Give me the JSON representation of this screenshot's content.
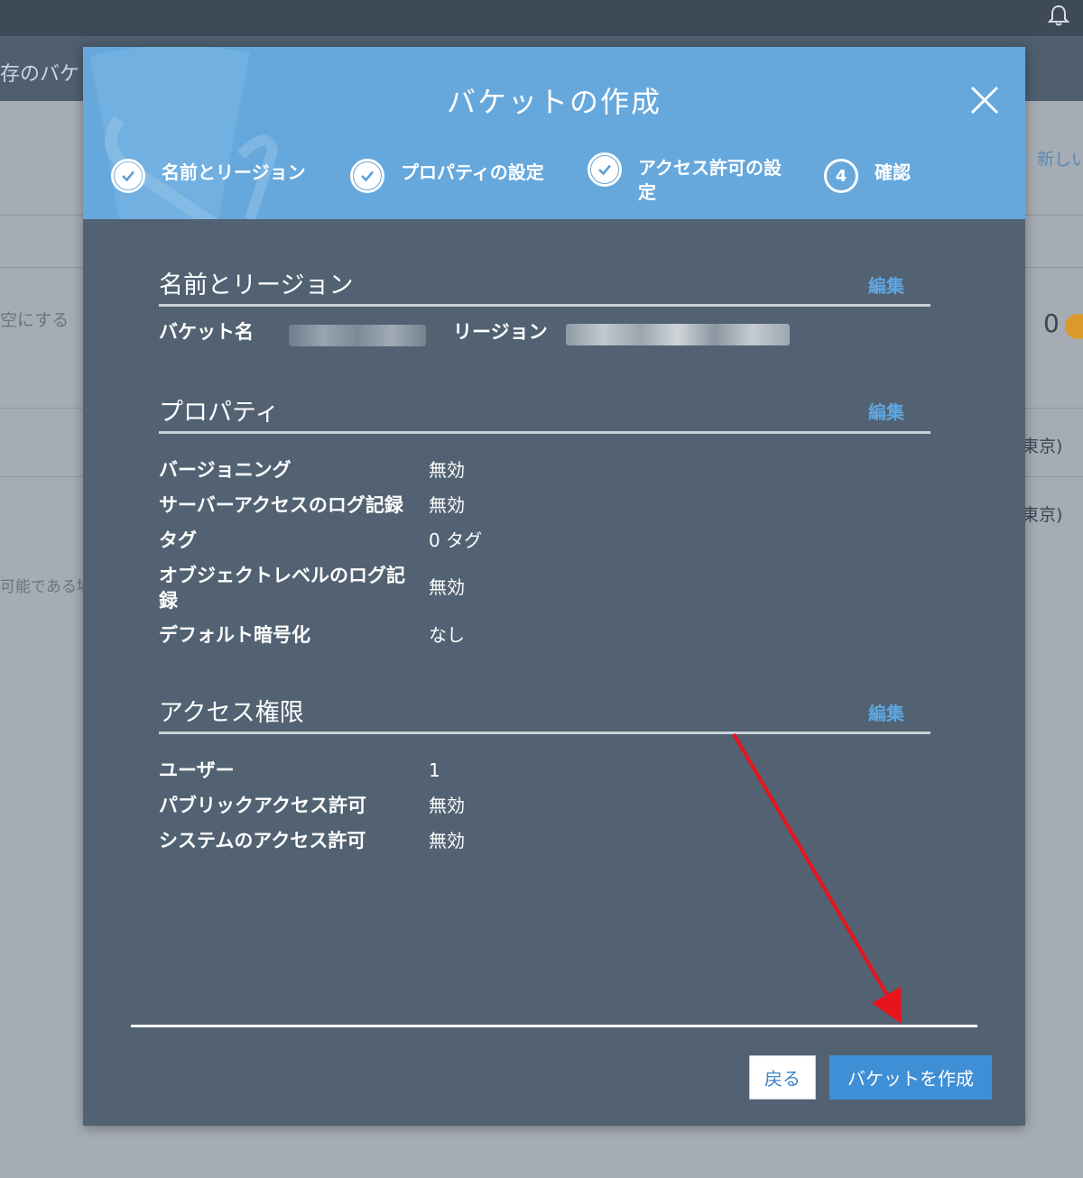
{
  "background": {
    "header_text": "存のバケッ",
    "right_link": "新しい",
    "empty_label": "空にする",
    "count": "0",
    "region_suffix_1": "東京)",
    "region_suffix_2": "東京)",
    "note": "可能である場"
  },
  "modal": {
    "title": "バケットの作成",
    "steps": [
      {
        "label": "名前とリージョン",
        "state": "done"
      },
      {
        "label": "プロパティの設定",
        "state": "done"
      },
      {
        "label_line1": "アクセス許可の設",
        "label_line2": "定",
        "state": "done"
      },
      {
        "number": "4",
        "label": "確認",
        "state": "current"
      }
    ],
    "edit_label": "編集",
    "sections": {
      "name_region": {
        "title": "名前とリージョン",
        "bucket_name_label": "バケット名",
        "region_label": "リージョン"
      },
      "properties": {
        "title": "プロパティ",
        "rows": [
          {
            "label": "バージョニング",
            "value": "無効"
          },
          {
            "label": "サーバーアクセスのログ記録",
            "value": "無効"
          },
          {
            "label": "タグ",
            "value": "0 タグ"
          },
          {
            "label_line1": "オブジェクトレベルのログ記",
            "label_line2": "録",
            "value": "無効"
          },
          {
            "label": "デフォルト暗号化",
            "value": "なし"
          }
        ]
      },
      "access": {
        "title": "アクセス権限",
        "rows": [
          {
            "label": "ユーザー",
            "value": "1"
          },
          {
            "label": "パブリックアクセス許可",
            "value": "無効"
          },
          {
            "label": "システムのアクセス許可",
            "value": "無効"
          }
        ]
      }
    },
    "buttons": {
      "back": "戻る",
      "create": "バケットを作成"
    }
  },
  "colors": {
    "header_blue": "#66a8dc",
    "modal_body": "#526272",
    "link_blue": "#5fa6e2",
    "primary_button": "#3f8fd6",
    "annotation_arrow": "#e8141b"
  }
}
